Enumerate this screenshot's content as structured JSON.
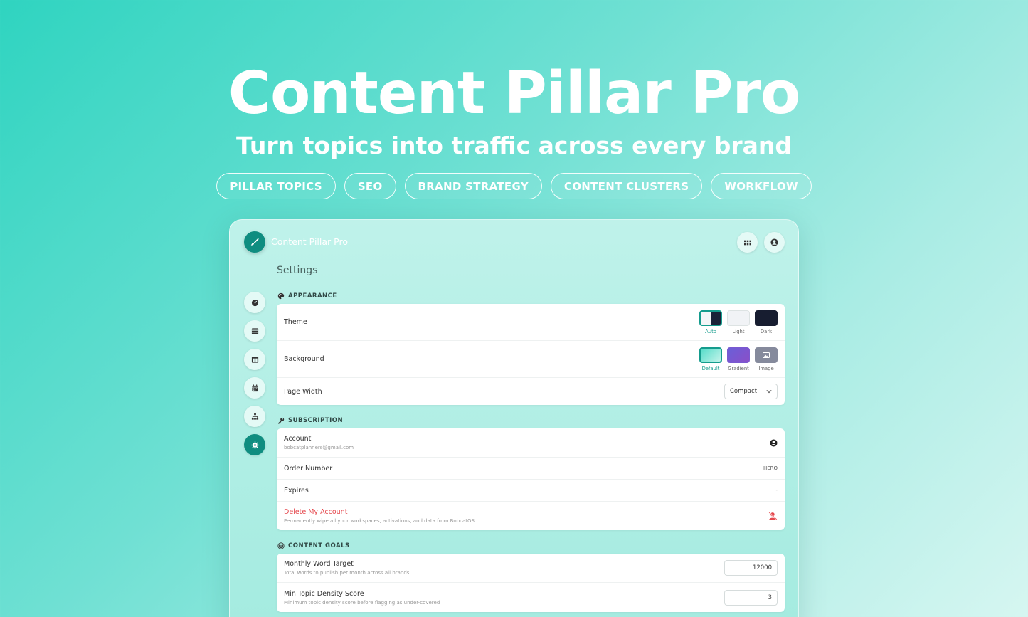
{
  "hero": {
    "title": "Content Pillar Pro",
    "subtitle": "Turn topics into traffic across every brand",
    "tags": [
      "PILLAR TOPICS",
      "SEO",
      "BRAND STRATEGY",
      "CONTENT CLUSTERS",
      "WORKFLOW"
    ]
  },
  "app": {
    "name": "Content Pillar Pro",
    "page_title": "Settings"
  },
  "appearance": {
    "header": "APPEARANCE",
    "theme_label": "Theme",
    "theme_options": [
      "Auto",
      "Light",
      "Dark"
    ],
    "theme_selected": "Auto",
    "background_label": "Background",
    "background_options": [
      "Default",
      "Gradient",
      "Image"
    ],
    "background_selected": "Default",
    "page_width_label": "Page Width",
    "page_width_value": "Compact"
  },
  "subscription": {
    "header": "SUBSCRIPTION",
    "account_label": "Account",
    "account_email": "bobcatplanners@gmail.com",
    "order_label": "Order Number",
    "order_value": "HERO",
    "expires_label": "Expires",
    "expires_value": "-",
    "delete_label": "Delete My Account",
    "delete_desc": "Permanently wipe all your workspaces, activations, and data from BobcatOS."
  },
  "goals": {
    "header": "CONTENT GOALS",
    "word_target_label": "Monthly Word Target",
    "word_target_desc": "Total words to publish per month across all brands",
    "word_target_value": "12000",
    "density_label": "Min Topic Density Score",
    "density_desc": "Minimum topic density score before flagging as under-covered",
    "density_value": "3"
  },
  "colors": {
    "accent": "#159c8d",
    "danger": "#e5484d"
  }
}
